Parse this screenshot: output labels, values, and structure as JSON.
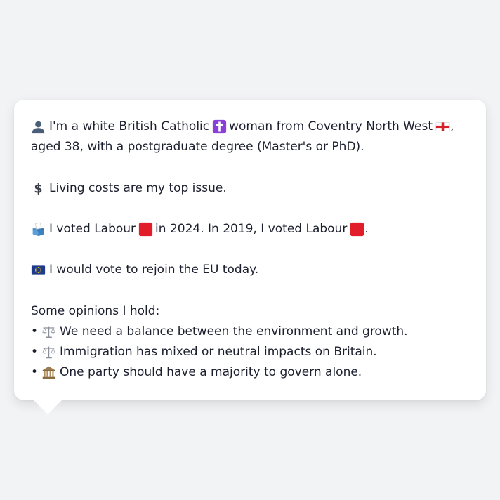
{
  "profile": {
    "intro": {
      "part1": "I'm a white British Catholic",
      "part2": "woman from Coventry North West",
      "part3": ",",
      "part4": "aged 38, with a postgraduate degree (Master's or PhD)."
    },
    "top_issue": "Living costs are my top issue.",
    "vote": {
      "part1": "I voted Labour",
      "part2": "in 2024. In 2019, I voted Labour",
      "part3": "."
    },
    "eu": "I would vote to rejoin the EU today.",
    "opinions_heading": "Some opinions I hold:",
    "opinions": [
      {
        "bullet": "•",
        "icon": "balance-scale-icon",
        "text": "We need a balance between the environment and growth."
      },
      {
        "bullet": "•",
        "icon": "balance-scale-icon",
        "text": "Immigration has mixed or neutral impacts on Britain."
      },
      {
        "bullet": "•",
        "icon": "government-building-icon",
        "text": "One party should have a majority to govern alone."
      }
    ]
  },
  "colors": {
    "background": "#f2f3f5",
    "card": "#ffffff",
    "text": "#1c1f2e",
    "labour_red": "#e11d2a",
    "eu_blue": "#1e3a8a",
    "cross_purple": "#8b3fd9"
  }
}
